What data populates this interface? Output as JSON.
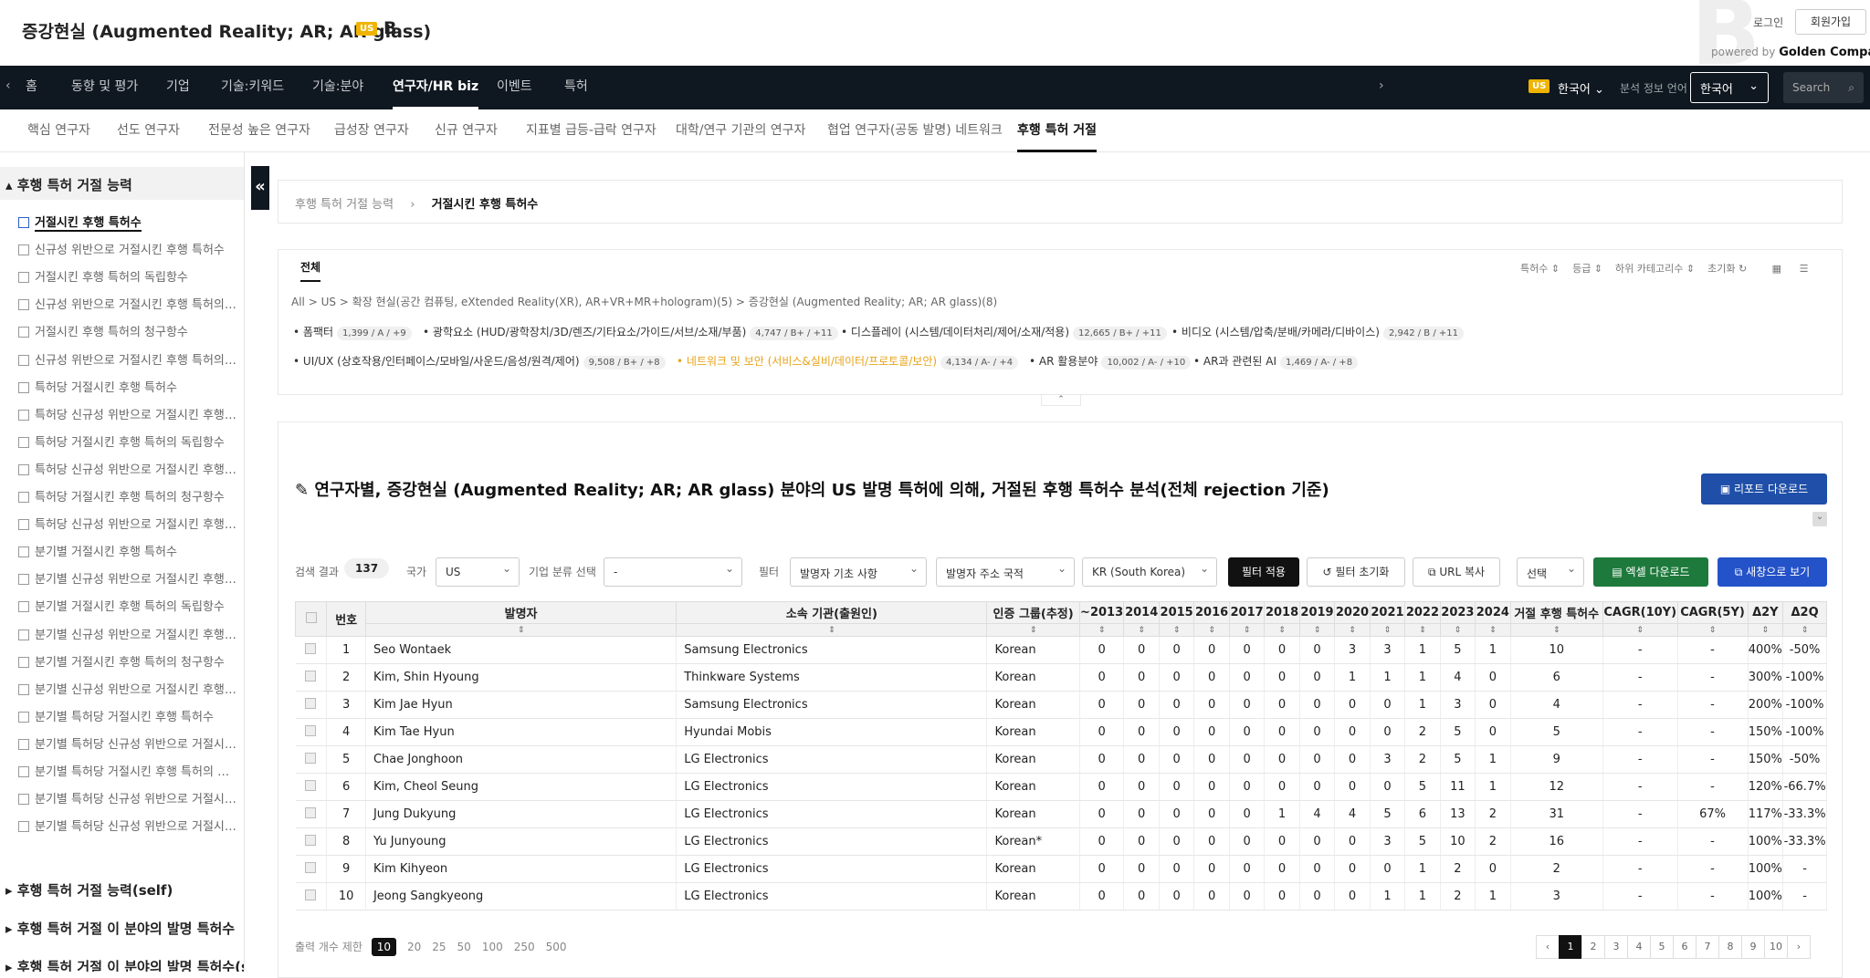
{
  "header": {
    "title": "증강현실 (Augmented Reality; AR; AR glass)",
    "flag": "US",
    "grade": "B",
    "login": "로그인",
    "signup": "회원가입",
    "powered_by": "powered by",
    "brand": "Golden Compass"
  },
  "nav": {
    "items": [
      "홈",
      "동향 및 평가",
      "기업",
      "기술:키워드",
      "기술:분야",
      "연구자/HR biz",
      "이벤트",
      "특허"
    ],
    "active": "연구자/HR biz",
    "country_flag": "US",
    "language": "한국어",
    "info_lang_label": "분석 정보 언어",
    "info_lang_value": "한국어",
    "search_placeholder": "Search"
  },
  "subnav": {
    "items": [
      "핵심 연구자",
      "선도 연구자",
      "전문성 높은 연구자",
      "급성장 연구자",
      "신규 연구자",
      "지표별 급등-급락 연구자",
      "대학/연구 기관의 연구자",
      "협업 연구자(공동 발명) 네트워크",
      "후행 특허 거절"
    ],
    "active": "후행 특허 거절"
  },
  "sidebar": {
    "section1": "후행 특허 거절 능력",
    "items": [
      "거절시킨 후행 특허수",
      "신규성 위반으로 거절시킨 후행 특허수",
      "거절시킨 후행 특허의 독립항수",
      "신규성 위반으로 거절시킨 후행 특허의 독립항수",
      "거절시킨 후행 특허의 청구항수",
      "신규성 위반으로 거절시킨 후행 특허의 청구항수",
      "특허당 거절시킨 후행 특허수",
      "특허당 신규성 위반으로 거절시킨 후행 특허수",
      "특허당 거절시킨 후행 특허의 독립항수",
      "특허당 신규성 위반으로 거절시킨 후행 특허의 독립항수",
      "특허당 거절시킨 후행 특허의 청구항수",
      "특허당 신규성 위반으로 거절시킨 후행 특허의 청구항수",
      "분기별 거절시킨 후행 특허수",
      "분기별 신규성 위반으로 거절시킨 후행 특허수",
      "분기별 거절시킨 후행 특허의 독립항수",
      "분기별 신규성 위반으로 거절시킨 후행 특허의 독립항수",
      "분기별 거절시킨 후행 특허의 청구항수",
      "분기별 신규성 위반으로 거절시킨 후행 특허의 청구항수",
      "분기별 특허당 거절시킨 후행 특허수",
      "분기별 특허당 신규성 위반으로 거절시킨 후행 특허수",
      "분기별 특허당 거절시킨 후행 특허의 독립항수",
      "분기별 특허당 신규성 위반으로 거절시킨 후행 특허의 독립항수",
      "분기별 특허당 신규성 위반으로 거절시킨 후행 특허수"
    ],
    "section2": "후행 특허 거절 능력(self)",
    "section3": "후행 특허 거절 이 분야의 발명 특허수",
    "section4": "후행 특허 거절 이 분야의 발명 특허수(self)"
  },
  "breadcrumb": {
    "parent": "후행 특허 거절 능력",
    "current": "거절시킨 후행 특허수"
  },
  "filters": {
    "tab": "전체",
    "sorts": [
      "특허수",
      "등급",
      "하위 카테고리수",
      "초기화"
    ],
    "path": [
      "All",
      "US",
      "확장 현실(공간 컴퓨팅, eXtended Reality(XR), AR+VR+MR+hologram)(5)",
      "증강현실 (Augmented Reality; AR; AR glass)(8)"
    ],
    "categories": [
      {
        "name": "폼팩터",
        "badge": "1,399 / A / +9"
      },
      {
        "name": "광학요소 (HUD/광학장치/3D/렌즈/기타요소/가이드/서브/소재/부품)",
        "badge": "4,747 / B+ / +11"
      },
      {
        "name": "디스플레이 (시스템/데이터처리/제어/소재/적용)",
        "badge": "12,665 / B+ / +11"
      },
      {
        "name": "비디오 (시스템/압축/분배/카메라/디바이스)",
        "badge": "2,942 / B / +11"
      },
      {
        "name": "UI/UX (상호작용/인터페이스/모바일/사운드/음성/원격/제어)",
        "badge": "9,508 / B+ / +8"
      },
      {
        "name": "네트워크 및 보안 (서비스&실비/데이터/프로토콜/보안)",
        "badge": "4,134 / A- / +4"
      },
      {
        "name": "AR 활용분야",
        "badge": "10,002 / A- / +10"
      },
      {
        "name": "AR과 관련된 AI",
        "badge": "1,469 / A- / +8"
      }
    ]
  },
  "content": {
    "title": "연구자별, 증강현실 (Augmented Reality; AR; AR glass) 분야의 US 발명 특허에 의해, 거절된 후행 특허수 분석(전체 rejection 기준)",
    "report_btn": "리포트 다운로드",
    "result_label": "검색 결과",
    "result_count": "137",
    "country_label": "국가",
    "country_value": "US",
    "corp_label": "기업 분류 선택",
    "corp_value": "-",
    "filter_label": "필터",
    "filter1": "발명자 기초 사항",
    "filter2": "발명자 주소 국적",
    "filter3": "KR (South Korea)",
    "apply_btn": "필터 적용",
    "reset_btn": "필터 초기화",
    "url_btn": "URL 복사",
    "select_btn": "선택",
    "excel_btn": "엑셀 다운로드",
    "newwin_btn": "새창으로 보기",
    "pagesize_label": "출력 개수 제한",
    "pagesizes": [
      "10",
      "20",
      "25",
      "50",
      "100",
      "250",
      "500"
    ],
    "pages": [
      "‹",
      "1",
      "2",
      "3",
      "4",
      "5",
      "6",
      "7",
      "8",
      "9",
      "10",
      "›"
    ]
  },
  "table": {
    "headers": [
      "번호",
      "발명자",
      "소속 기관(출원인)",
      "인증 그룹(추정)",
      "~2013",
      "2014",
      "2015",
      "2016",
      "2017",
      "2018",
      "2019",
      "2020",
      "2021",
      "2022",
      "2023",
      "2024",
      "거절 후행 특허수",
      "CAGR(10Y)",
      "CAGR(5Y)",
      "Δ2Y",
      "Δ2Q"
    ],
    "rows": [
      [
        "1",
        "Seo Wontaek",
        "Samsung Electronics",
        "Korean",
        "0",
        "0",
        "0",
        "0",
        "0",
        "0",
        "0",
        "3",
        "3",
        "1",
        "5",
        "1",
        "10",
        "-",
        "-",
        "400%",
        "-50%"
      ],
      [
        "2",
        "Kim, Shin Hyoung",
        "Thinkware Systems",
        "Korean",
        "0",
        "0",
        "0",
        "0",
        "0",
        "0",
        "0",
        "1",
        "1",
        "1",
        "4",
        "0",
        "6",
        "-",
        "-",
        "300%",
        "-100%"
      ],
      [
        "3",
        "Kim Jae Hyun",
        "Samsung Electronics",
        "Korean",
        "0",
        "0",
        "0",
        "0",
        "0",
        "0",
        "0",
        "0",
        "0",
        "1",
        "3",
        "0",
        "4",
        "-",
        "-",
        "200%",
        "-100%"
      ],
      [
        "4",
        "Kim Tae Hyun",
        "Hyundai Mobis",
        "Korean",
        "0",
        "0",
        "0",
        "0",
        "0",
        "0",
        "0",
        "0",
        "0",
        "2",
        "5",
        "0",
        "5",
        "-",
        "-",
        "150%",
        "-100%"
      ],
      [
        "5",
        "Chae Jonghoon",
        "LG Electronics",
        "Korean",
        "0",
        "0",
        "0",
        "0",
        "0",
        "0",
        "0",
        "0",
        "3",
        "2",
        "5",
        "1",
        "9",
        "-",
        "-",
        "150%",
        "-50%"
      ],
      [
        "6",
        "Kim, Cheol Seung",
        "LG Electronics",
        "Korean",
        "0",
        "0",
        "0",
        "0",
        "0",
        "0",
        "0",
        "0",
        "0",
        "5",
        "11",
        "1",
        "12",
        "-",
        "-",
        "120%",
        "-66.7%"
      ],
      [
        "7",
        "Jung Dukyung",
        "LG Electronics",
        "Korean",
        "0",
        "0",
        "0",
        "0",
        "0",
        "1",
        "4",
        "4",
        "5",
        "6",
        "13",
        "2",
        "31",
        "-",
        "67%",
        "117%",
        "-33.3%"
      ],
      [
        "8",
        "Yu Junyoung",
        "LG Electronics",
        "Korean*",
        "0",
        "0",
        "0",
        "0",
        "0",
        "0",
        "0",
        "0",
        "3",
        "5",
        "10",
        "2",
        "16",
        "-",
        "-",
        "100%",
        "-33.3%"
      ],
      [
        "9",
        "Kim Kihyeon",
        "LG Electronics",
        "Korean",
        "0",
        "0",
        "0",
        "0",
        "0",
        "0",
        "0",
        "0",
        "0",
        "1",
        "2",
        "0",
        "2",
        "-",
        "-",
        "100%",
        "-"
      ],
      [
        "10",
        "Jeong Sangkyeong",
        "LG Electronics",
        "Korean",
        "0",
        "0",
        "0",
        "0",
        "0",
        "0",
        "0",
        "0",
        "1",
        "1",
        "2",
        "1",
        "3",
        "-",
        "-",
        "100%",
        "-"
      ]
    ]
  }
}
